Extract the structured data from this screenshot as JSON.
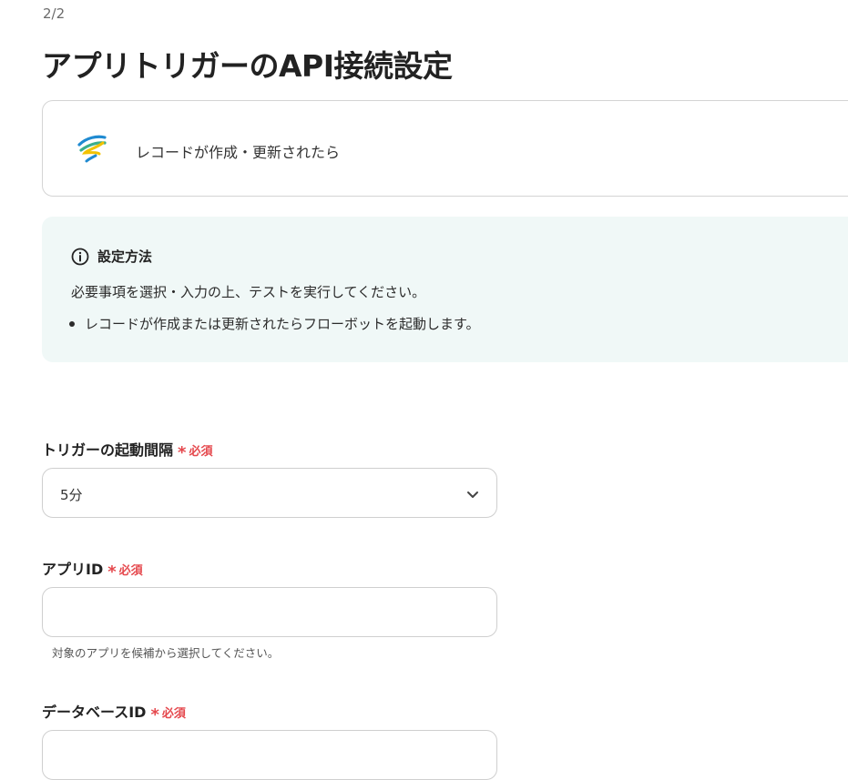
{
  "page": {
    "step": "2/2",
    "title": "アプリトリガーのAPI接続設定"
  },
  "trigger": {
    "app_icon": "kintone-swirl-logo",
    "label": "レコードが作成・更新されたら"
  },
  "info": {
    "icon": "info-circle-icon",
    "title": "設定方法",
    "description": "必要事項を選択・入力の上、テストを実行してください。",
    "bullets": [
      "レコードが作成または更新されたらフローボットを起動します。"
    ]
  },
  "form": {
    "required_star": "*",
    "required_text": "必須",
    "interval": {
      "label": "トリガーの起動間隔",
      "value": "5分",
      "icon": "chevron-down-icon"
    },
    "app_id": {
      "label": "アプリID",
      "value": "",
      "placeholder": "",
      "hint": "対象のアプリを候補から選択してください。"
    },
    "database_id": {
      "label": "データベースID"
    }
  },
  "colors": {
    "required": "#e5484d",
    "info_bg": "#f0f8f7",
    "border": "#cfcfcf"
  }
}
